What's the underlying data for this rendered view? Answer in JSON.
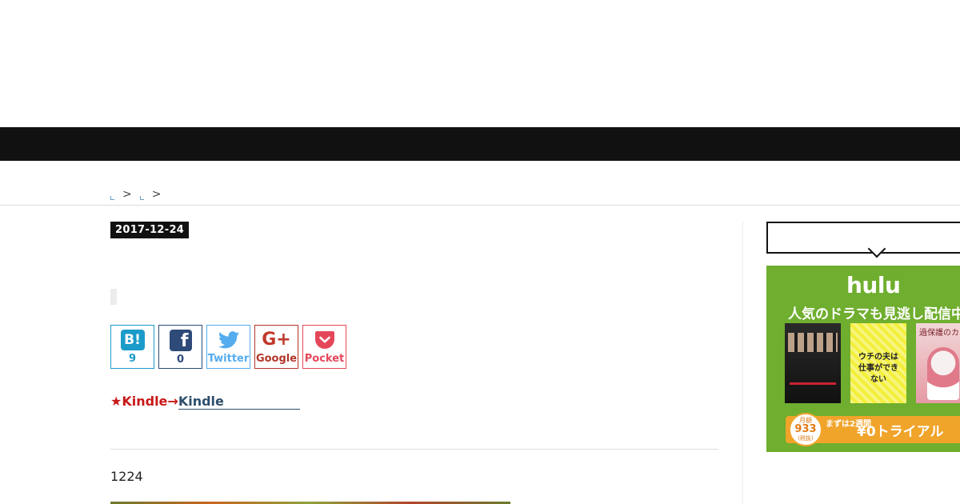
{
  "breadcrumb": {
    "separator_1": ">",
    "separator_2": ">"
  },
  "article": {
    "date": "2017-12-24",
    "kindle_prefix": "★Kindle→",
    "kindle_link": "Kindle",
    "body_text": "1224"
  },
  "share": {
    "hatena": {
      "icon": "hatena-bookmark-icon",
      "glyph": "B!",
      "count": "9"
    },
    "facebook": {
      "icon": "facebook-icon",
      "glyph": "f",
      "count": "0"
    },
    "twitter": {
      "icon": "twitter-bird-icon",
      "label": "Twitter"
    },
    "google": {
      "icon": "google-plus-icon",
      "glyph": "G+",
      "label": "Google"
    },
    "pocket": {
      "icon": "pocket-icon",
      "label": "Pocket"
    }
  },
  "hulu_ad": {
    "logo": "hulu",
    "tagline": "人気のドラマも見逃し配信中",
    "poster_2_title": "ウチの夫は仕事ができない",
    "poster_3_title": "過保護のカホコ",
    "price_top": "月額",
    "price": "933",
    "price_note": "(税抜)",
    "cta_small": "まずは2週間",
    "cta_main": "¥0トライアル"
  },
  "colors": {
    "navbar": "#111111",
    "date_badge": "#111111",
    "hatena": "#1b9bc9",
    "facebook": "#2d4a79",
    "twitter": "#55acee",
    "google": "#b3362a",
    "pocket": "#e5475a",
    "kindle_red": "#c81818",
    "hulu_green": "#6fae2e",
    "hulu_cta": "#f1a42a"
  }
}
